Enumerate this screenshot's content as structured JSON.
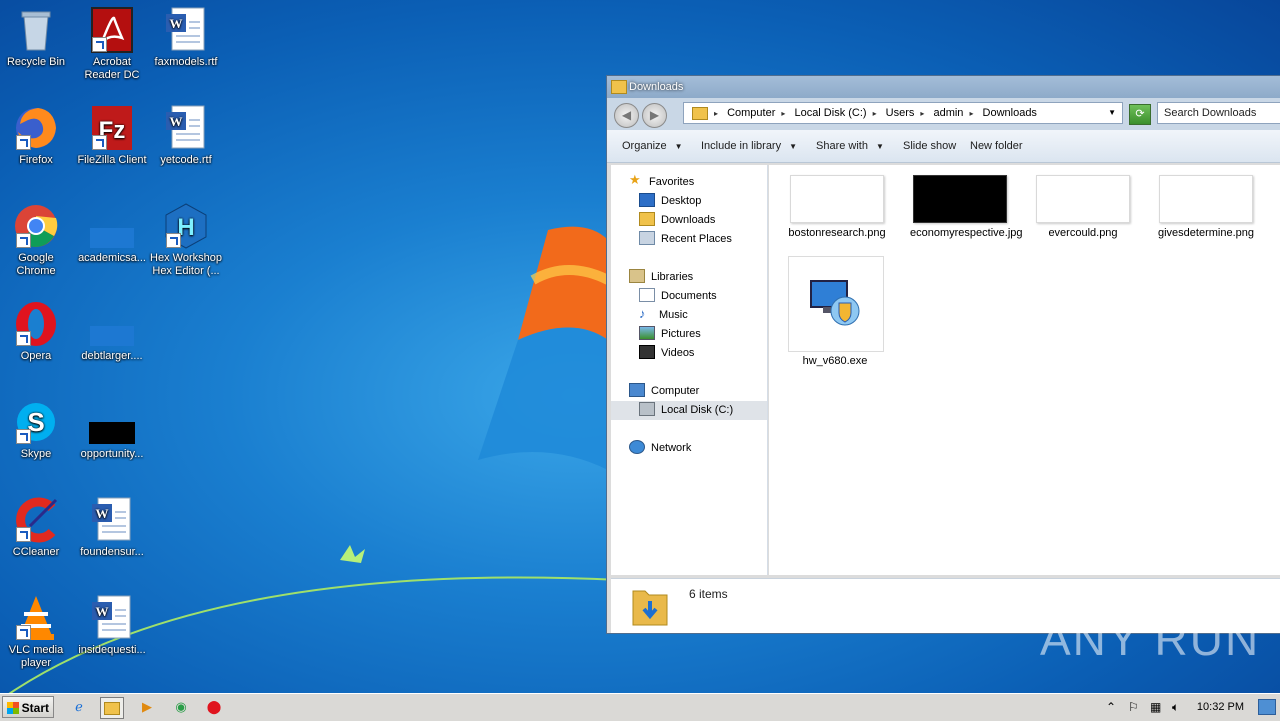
{
  "desktop": {
    "icons": [
      {
        "label": "Recycle Bin",
        "icon": "recycle-bin-icon"
      },
      {
        "label": "Acrobat Reader DC",
        "icon": "acrobat-icon"
      },
      {
        "label": "faxmodels.rtf",
        "icon": "word-document-icon"
      },
      {
        "label": "Firefox",
        "icon": "firefox-icon"
      },
      {
        "label": "FileZilla Client",
        "icon": "filezilla-icon"
      },
      {
        "label": "yetcode.rtf",
        "icon": "word-document-icon"
      },
      {
        "label": "Google Chrome",
        "icon": "chrome-icon"
      },
      {
        "label": "academicsa...",
        "icon": "blank-file-icon"
      },
      {
        "label": "Hex Workshop Hex Editor (...",
        "icon": "hex-workshop-icon"
      },
      {
        "label": "Opera",
        "icon": "opera-icon"
      },
      {
        "label": "debtlarger....",
        "icon": "blank-file-icon"
      },
      {
        "label": "Skype",
        "icon": "skype-icon"
      },
      {
        "label": "opportunity...",
        "icon": "black-image-icon"
      },
      {
        "label": "CCleaner",
        "icon": "ccleaner-icon"
      },
      {
        "label": "foundensur...",
        "icon": "word-document-icon"
      },
      {
        "label": "VLC media player",
        "icon": "vlc-icon"
      },
      {
        "label": "insidequesti...",
        "icon": "word-document-icon"
      }
    ]
  },
  "window": {
    "title": "Downloads",
    "breadcrumb": [
      "Computer",
      "Local Disk (C:)",
      "Users",
      "admin",
      "Downloads"
    ],
    "search_placeholder": "Search Downloads",
    "toolbar": {
      "organize": "Organize",
      "include_in_library": "Include in library",
      "share_with": "Share with",
      "slide_show": "Slide show",
      "new_folder": "New folder"
    },
    "nav": {
      "favorites": "Favorites",
      "desktop": "Desktop",
      "downloads": "Downloads",
      "recent_places": "Recent Places",
      "libraries": "Libraries",
      "documents": "Documents",
      "music": "Music",
      "pictures": "Pictures",
      "videos": "Videos",
      "computer": "Computer",
      "local_disk": "Local Disk (C:)",
      "network": "Network"
    },
    "files": [
      {
        "name": "bostonresearch.png",
        "thumb": "white"
      },
      {
        "name": "economyrespective.jpg",
        "thumb": "black"
      },
      {
        "name": "evercould.png",
        "thumb": "white"
      },
      {
        "name": "givesdetermine.png",
        "thumb": "white"
      },
      {
        "name": "hw_v680.exe",
        "thumb": "installer"
      }
    ],
    "status": "6 items"
  },
  "watermark": "ANY RUN",
  "taskbar": {
    "start_label": "Start",
    "clock": "10:32 PM"
  },
  "colors": {
    "desktop_blue": "#1a7fd0",
    "title_bar": "#8daac9",
    "taskbar": "#dad9d6"
  }
}
